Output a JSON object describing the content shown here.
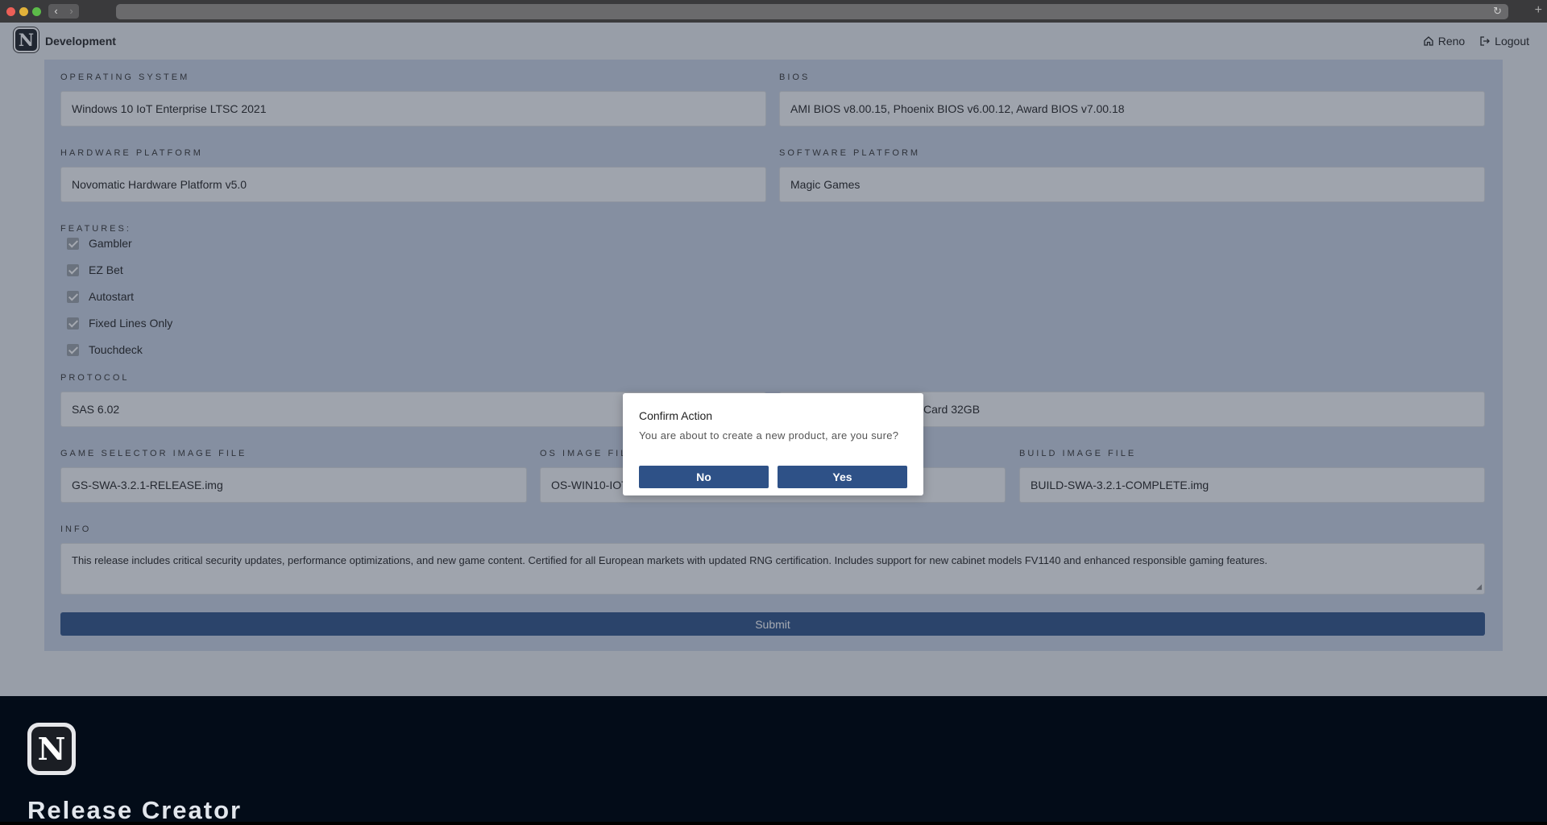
{
  "browser": {
    "back_glyph": "‹",
    "forward_glyph": "›",
    "reload_glyph": "↻",
    "newtab_glyph": "+"
  },
  "header": {
    "logo_letter": "N",
    "env_title": "Development",
    "home_link": "Reno",
    "logout_link": "Logout",
    "home_icon": "home-icon",
    "logout_icon": "logout-icon"
  },
  "form": {
    "operating_system": {
      "label": "OPERATING SYSTEM",
      "value": "Windows 10 IoT Enterprise LTSC 2021"
    },
    "bios": {
      "label": "BIOS",
      "value": "AMI BIOS v8.00.15, Phoenix BIOS v6.00.12, Award BIOS v7.00.18"
    },
    "hardware_platform": {
      "label": "HARDWARE PLATFORM",
      "value": "Novomatic Hardware Platform v5.0"
    },
    "software_platform": {
      "label": "SOFTWARE PLATFORM",
      "value": "Magic Games"
    },
    "features_label": "FEATURES:",
    "features": [
      "Gambler",
      "EZ Bet",
      "Autostart",
      "Fixed Lines Only",
      "Touchdeck"
    ],
    "protocol": {
      "label": "PROTOCOL",
      "value": "SAS 6.02"
    },
    "storage": {
      "value_partial": "Card 32GB"
    },
    "game_selector_image": {
      "label": "GAME SELECTOR IMAGE FILE",
      "value": "GS-SWA-3.2.1-RELEASE.img"
    },
    "os_image": {
      "label_partial": "OS IMAGE FIL",
      "value": "OS-WIN10-IOT-LTSC-2021-v3.img"
    },
    "build_image": {
      "label": "BUILD IMAGE FILE",
      "value": "BUILD-SWA-3.2.1-COMPLETE.img"
    },
    "info": {
      "label": "INFO",
      "value": "This release includes critical security updates, performance optimizations, and new game content. Certified for all European markets with updated RNG certification. Includes support for new cabinet models FV1140 and enhanced responsible gaming features."
    },
    "submit_label": "Submit"
  },
  "dialog": {
    "title": "Confirm Action",
    "message": "You are about to create a new product, are you sure?",
    "no_label": "No",
    "yes_label": "Yes"
  },
  "footer": {
    "logo_letter": "N",
    "title": "Release Creator"
  },
  "colors": {
    "primary": "#2e5187",
    "footer_bg": "#030c18",
    "panel_bg": "#c9d3e3"
  }
}
